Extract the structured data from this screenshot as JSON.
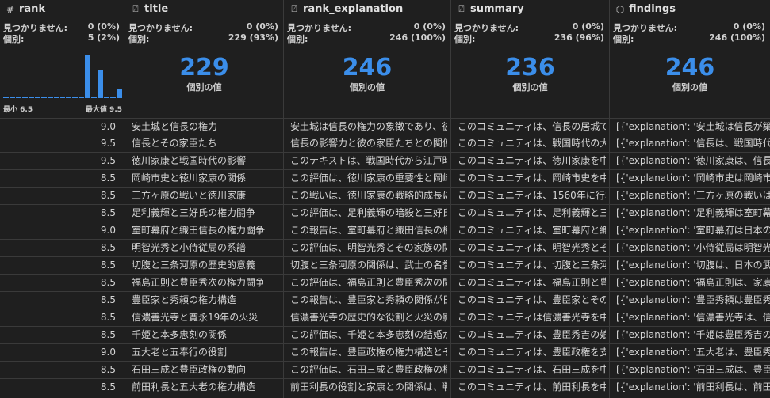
{
  "labels": {
    "not_found": "見つかりません:",
    "distinct": "個別:",
    "distinct_values": "個別の値",
    "min": "最小 6.5",
    "max": "最大値 9.5"
  },
  "icons": {
    "rank": "number-icon",
    "text": "text-type-icon",
    "object": "cube-icon"
  },
  "columns": [
    {
      "name": "rank",
      "missing": "0 (0%)",
      "distinct": "5 (2%)"
    },
    {
      "name": "title",
      "missing": "0 (0%)",
      "distinct": "229 (93%)",
      "distinct_count": "229"
    },
    {
      "name": "rank_explanation",
      "missing": "0 (0%)",
      "distinct": "246 (100%)",
      "distinct_count": "246"
    },
    {
      "name": "summary",
      "missing": "0 (0%)",
      "distinct": "236 (96%)",
      "distinct_count": "236"
    },
    {
      "name": "findings",
      "missing": "0 (0%)",
      "distinct": "246 (100%)",
      "distinct_count": "246"
    }
  ],
  "histogram": [
    0.02,
    0.02,
    0.02,
    0.04,
    0.04,
    0.04,
    0.04,
    0.04,
    0.04,
    0.04,
    0.04,
    0.04,
    0.04,
    1.0,
    0.04,
    0.64,
    0.04,
    0.04,
    0.2
  ],
  "colors": {
    "accent": "#3b8eea",
    "background": "#1f1f1f",
    "grid": "#3a3a3a"
  },
  "rows": [
    {
      "rank": "9.0",
      "title": "安土城と信長の権力",
      "rank_explanation": "安土城は信長の権力の象徴であり、彼",
      "summary": "このコミュニティは、信長の居城で",
      "findings": "[{'explanation': '安土城は信長が築城"
    },
    {
      "rank": "9.5",
      "title": "信長とその家臣たち",
      "rank_explanation": "信長の影響力と彼の家臣たちとの関係",
      "summary": "このコミュニティは、戦国時代の大",
      "findings": "[{'explanation': '信長は、戦国時代に"
    },
    {
      "rank": "9.5",
      "title": "徳川家康と戦国時代の影響",
      "rank_explanation": "このテキストは、戦国時代から江戸時",
      "summary": "このコミュニティは、徳川家康を中",
      "findings": "[{'explanation': '徳川家康は、信長の"
    },
    {
      "rank": "8.5",
      "title": "岡崎市史と徳川家康の関係",
      "rank_explanation": "この評価は、徳川家康の重要性と岡崎",
      "summary": "このコミュニティは、岡崎市史を中",
      "findings": "[{'explanation': '岡崎市史は岡崎市の"
    },
    {
      "rank": "8.5",
      "title": "三方ヶ原の戦いと徳川家康",
      "rank_explanation": "この戦いは、徳川家康の戦略的成長に",
      "summary": "このコミュニティは、1560年に行わ",
      "findings": "[{'explanation': '三方ヶ原の戦いは、"
    },
    {
      "rank": "8.5",
      "title": "足利義輝と三好氏の権力闘争",
      "rank_explanation": "この評価は、足利義輝の暗殺と三好氏",
      "summary": "このコミュニティは、足利義輝と三",
      "findings": "[{'explanation': '足利義輝は室町幕府"
    },
    {
      "rank": "9.0",
      "title": "室町幕府と織田信長の権力闘争",
      "rank_explanation": "この報告は、室町幕府と織田信長の権",
      "summary": "このコミュニティは、室町幕府と織",
      "findings": "[{'explanation': '室町幕府は日本の歴"
    },
    {
      "rank": "8.5",
      "title": "明智光秀と小侍従局の系譜",
      "rank_explanation": "この評価は、明智光秀とその家族の関",
      "summary": "このコミュニティは、明智光秀とそ",
      "findings": "[{'explanation': '小侍従局は明智光秀"
    },
    {
      "rank": "8.5",
      "title": "切腹と三条河原の歴史的意義",
      "rank_explanation": "切腹と三条河原の関係は、武士の名誉",
      "summary": "このコミュニティは、切腹と三条河",
      "findings": "[{'explanation': '切腹は、日本の武士"
    },
    {
      "rank": "8.5",
      "title": "福島正則と豊臣秀次の権力闘争",
      "rank_explanation": "この評価は、福島正則と豊臣秀次の関",
      "summary": "このコミュニティは、福島正則と豊",
      "findings": "[{'explanation': '福島正則は、家康に"
    },
    {
      "rank": "8.5",
      "title": "豊臣家と秀頼の権力構造",
      "rank_explanation": "この報告は、豊臣家と秀頼の関係が日",
      "summary": "このコミュニティは、豊臣家とその",
      "findings": "[{'explanation': '豊臣秀頼は豊臣秀吉"
    },
    {
      "rank": "8.5",
      "title": "信濃善光寺と寛永19年の火災",
      "rank_explanation": "信濃善光寺の歴史的な役割と火災の影",
      "summary": "このコミュニティは信濃善光寺を中",
      "findings": "[{'explanation': '信濃善光寺は、信仰"
    },
    {
      "rank": "8.5",
      "title": "千姫と本多忠刻の関係",
      "rank_explanation": "この評価は、千姫と本多忠刻の結婚が",
      "summary": "このコミュニティは、豊臣秀吉の娘",
      "findings": "[{'explanation': '千姫は豊臣秀吉の娘"
    },
    {
      "rank": "9.0",
      "title": "五大老と五奉行の役割",
      "rank_explanation": "この報告は、豊臣政権の権力構造とそ",
      "summary": "このコミュニティは、豊臣政権を支",
      "findings": "[{'explanation': '五大老は、豊臣秀吉"
    },
    {
      "rank": "8.5",
      "title": "石田三成と豊臣政権の動向",
      "rank_explanation": "この評価は、石田三成と豊臣政権の権",
      "summary": "このコミュニティは、石田三成を中",
      "findings": "[{'explanation': '石田三成は、豊臣秀"
    },
    {
      "rank": "8.5",
      "title": "前田利長と五大老の権力構造",
      "rank_explanation": "前田利長の役割と家康との関係は、戦",
      "summary": "このコミュニティは、前田利長を中",
      "findings": "[{'explanation': '前田利長は、前田家"
    }
  ]
}
